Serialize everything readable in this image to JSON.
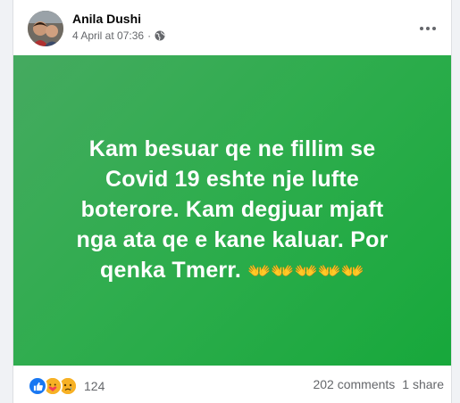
{
  "post": {
    "author": "Anila Dushi",
    "timestamp": "4 April at 07:36",
    "separator": "·",
    "privacy_icon": "globe-icon",
    "menu_icon": "more-options-icon",
    "text": "Kam besuar qe ne fillim se Covid 19 eshte nje lufte boterore. Kam degjuar mjaft nga ata qe e kane kaluar. Por qenka Tmerr.",
    "emojis": "👐👐👐👐👐",
    "background_color": "#2fad4e"
  },
  "footer": {
    "reactions": [
      "like-icon",
      "love-icon",
      "sad-icon"
    ],
    "reaction_count": "124",
    "comments": "202 comments",
    "shares": "1 share"
  },
  "colors": {
    "like": "#1877f2",
    "text_secondary": "#65676b"
  }
}
